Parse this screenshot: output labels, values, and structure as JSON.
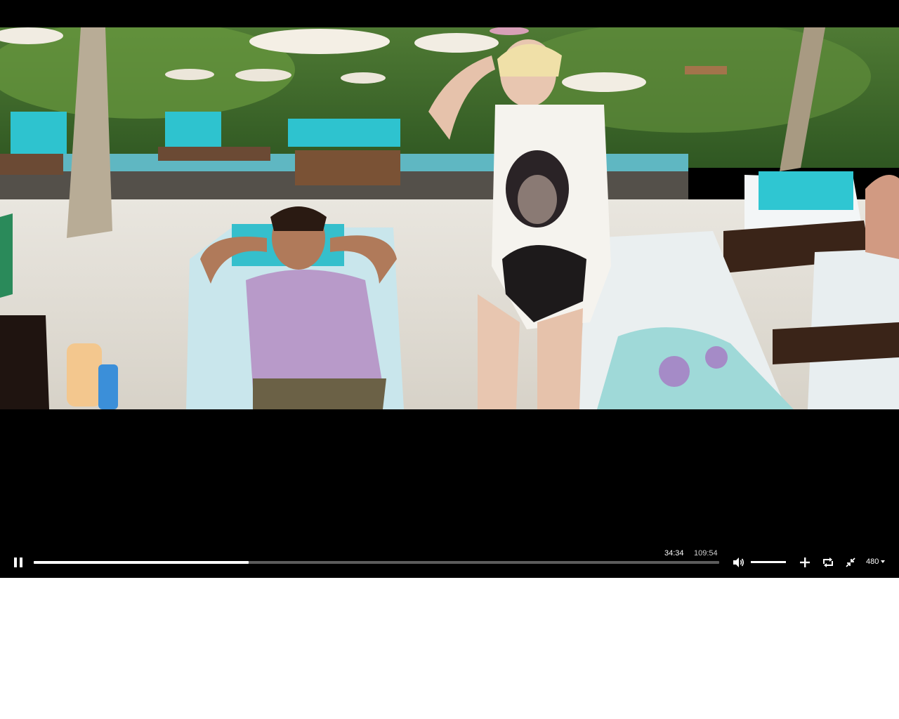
{
  "player": {
    "current_time": "34:34",
    "duration": "109:54",
    "progress_fraction": 0.314,
    "volume_fraction": 1.0,
    "quality_label": "480",
    "state": "playing"
  },
  "icons": {
    "play_pause": "pause-icon",
    "volume": "volume-icon",
    "zoom": "plus-icon",
    "loop": "loop-icon",
    "fullscreen": "exit-fullscreen-icon",
    "quality_menu": "chevron-down-icon"
  },
  "colors": {
    "player_background": "#000000",
    "control_foreground": "#ffffff",
    "track_background": "#5c5c5c"
  }
}
